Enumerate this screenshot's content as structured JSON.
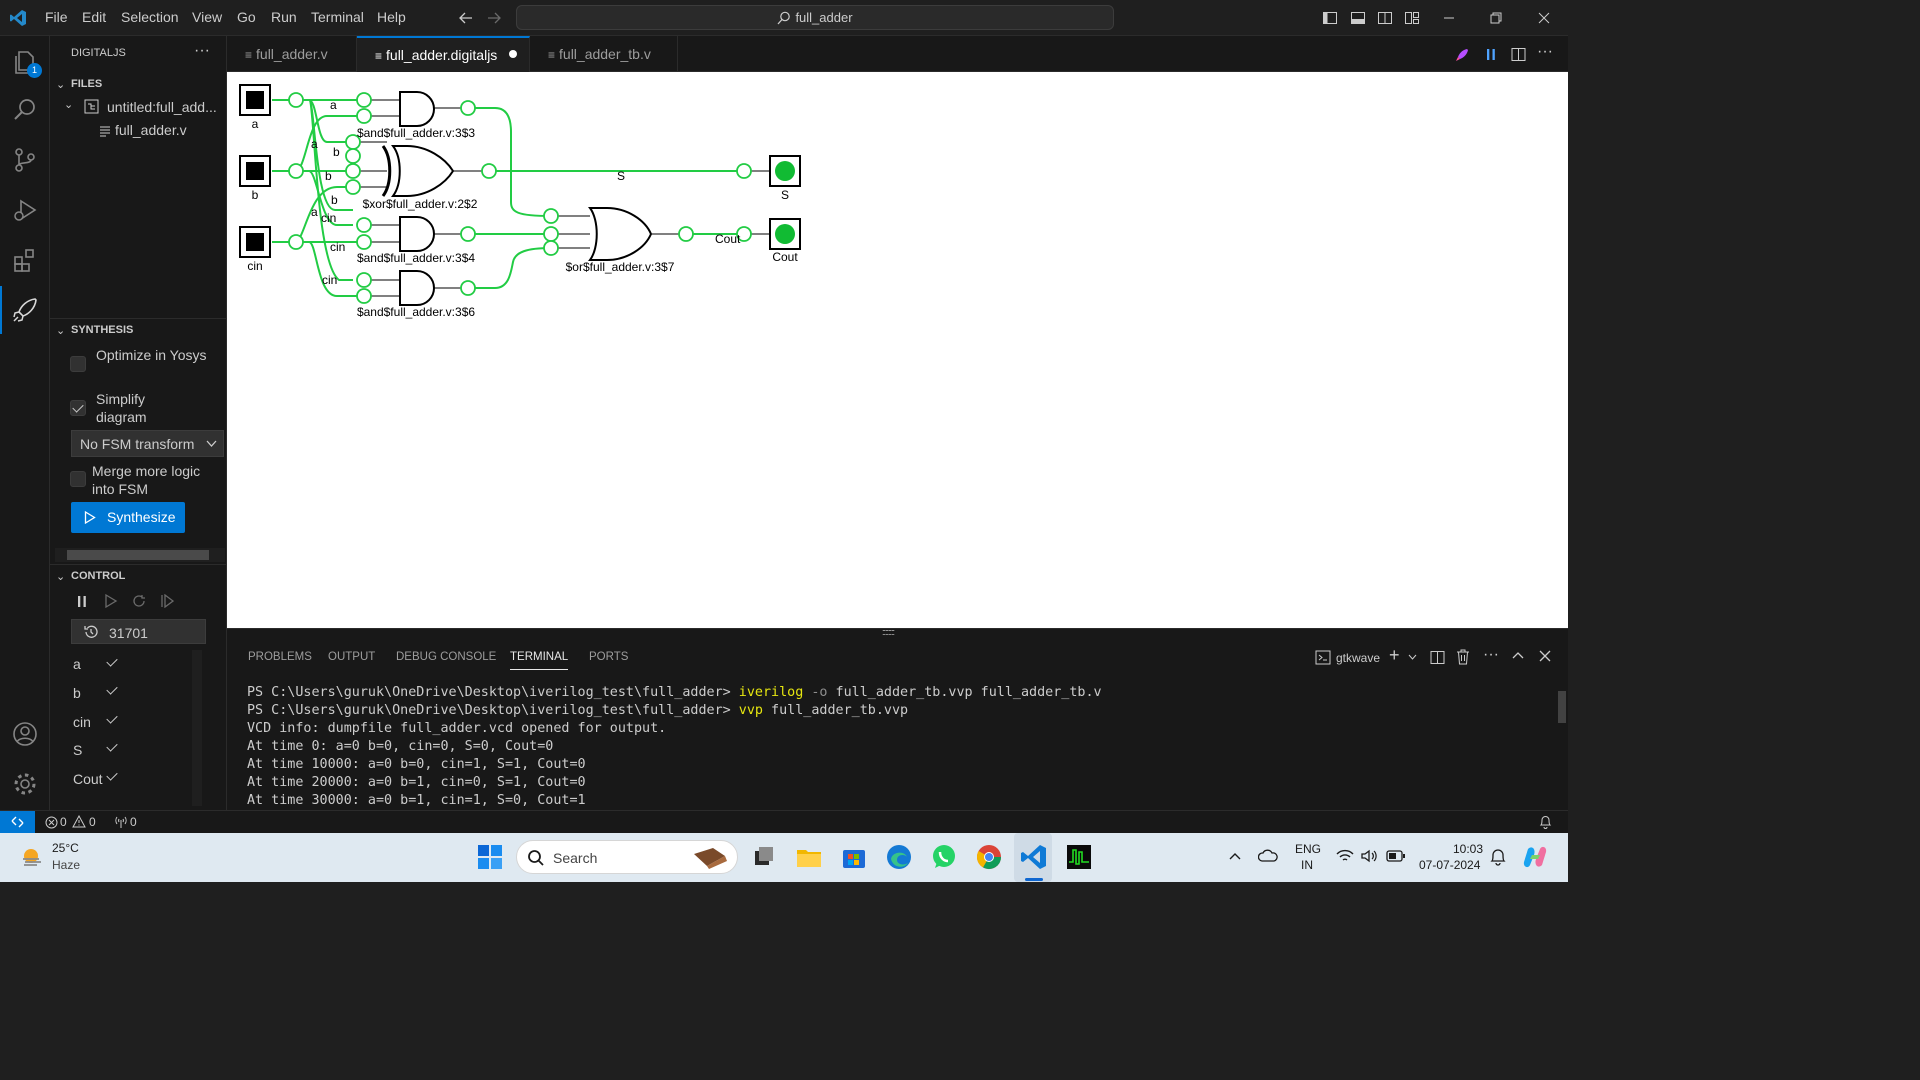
{
  "menu": [
    "File",
    "Edit",
    "Selection",
    "View",
    "Go",
    "Run",
    "Terminal",
    "Help"
  ],
  "search": {
    "text": "full_adder"
  },
  "sidebar": {
    "title": "DIGITALJS",
    "files_header": "FILES",
    "tree": {
      "root": "untitled:full_add...",
      "child": "full_adder.v"
    },
    "synthesis_header": "SYNTHESIS",
    "options": [
      {
        "label": "Optimize in Yosys",
        "checked": false
      },
      {
        "label": "Simplify diagram",
        "checked": true
      },
      {
        "label": "Merge more logic into FSM",
        "checked": false
      }
    ],
    "fsm_select": "No FSM transform",
    "synthesize_button": "Synthesize",
    "control_header": "CONTROL",
    "tick": "31701",
    "signals": [
      {
        "name": "a",
        "checked": true
      },
      {
        "name": "b",
        "checked": true
      },
      {
        "name": "cin",
        "checked": true
      },
      {
        "name": "S",
        "checked": true
      },
      {
        "name": "Cout",
        "checked": true
      }
    ],
    "badge": "1"
  },
  "tabs": [
    {
      "label": "full_adder.v",
      "active": false,
      "dirty": false
    },
    {
      "label": "full_adder.digitaljs",
      "active": true,
      "dirty": true
    },
    {
      "label": "full_adder_tb.v",
      "active": false,
      "dirty": false
    }
  ],
  "circuit": {
    "inputs": [
      "a",
      "b",
      "cin"
    ],
    "outputs": [
      "S",
      "Cout"
    ],
    "gates": {
      "and3": "$and$full_adder.v:3$3",
      "xor": "$xor$full_adder.v:2$2",
      "and4": "$and$full_adder.v:3$4",
      "and6": "$and$full_adder.v:3$6",
      "or7": "$or$full_adder.v:3$7"
    },
    "wire_labels": {
      "a": "a",
      "b": "b",
      "cin": "cin",
      "s": "S",
      "cout": "Cout"
    },
    "colors": {
      "wire_high": "#22cc44",
      "output_lamp": "#11bb33"
    }
  },
  "panel": {
    "tabs": [
      "PROBLEMS",
      "OUTPUT",
      "DEBUG CONSOLE",
      "TERMINAL",
      "PORTS"
    ],
    "active_tab": "TERMINAL",
    "shell_name": "gtkwave",
    "lines": [
      {
        "prompt": "PS C:\\Users\\guruk\\OneDrive\\Desktop\\iverilog_test\\full_adder> ",
        "cmd": "iverilog",
        "flag": " -o",
        "rest": " full_adder_tb.vvp full_adder_tb.v"
      },
      {
        "prompt": "PS C:\\Users\\guruk\\OneDrive\\Desktop\\iverilog_test\\full_adder> ",
        "cmd": "vvp",
        "flag": "",
        "rest": " full_adder_tb.vvp"
      },
      {
        "prompt": "VCD info: dumpfile full_adder.vcd opened for output.",
        "cmd": "",
        "flag": "",
        "rest": ""
      },
      {
        "prompt": "At time 0: a=0 b=0, cin=0, S=0, Cout=0",
        "cmd": "",
        "flag": "",
        "rest": ""
      },
      {
        "prompt": "At time 10000: a=0 b=0, cin=1, S=1, Cout=0",
        "cmd": "",
        "flag": "",
        "rest": ""
      },
      {
        "prompt": "At time 20000: a=0 b=1, cin=0, S=1, Cout=0",
        "cmd": "",
        "flag": "",
        "rest": ""
      },
      {
        "prompt": "At time 30000: a=0 b=1, cin=1, S=0, Cout=1",
        "cmd": "",
        "flag": "",
        "rest": ""
      }
    ]
  },
  "status": {
    "errors": "0",
    "warnings": "0",
    "ports": "0"
  },
  "taskbar": {
    "weather_temp": "25°C",
    "weather_desc": "Haze",
    "search_placeholder": "Search",
    "lang1": "ENG",
    "lang2": "IN",
    "time": "10:03",
    "date": "07-07-2024"
  }
}
